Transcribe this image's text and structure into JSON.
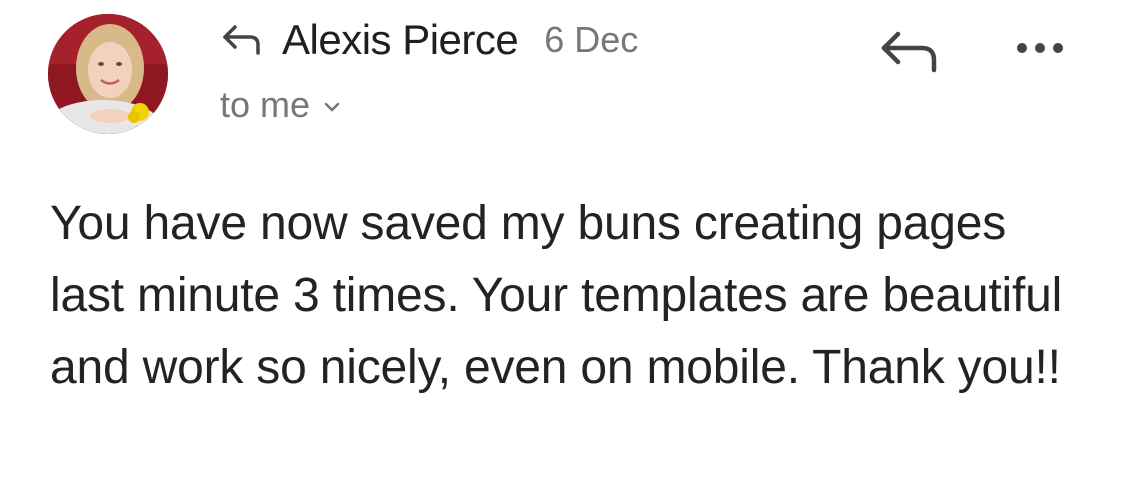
{
  "email": {
    "sender": {
      "name": "Alexis Pierce",
      "avatar_icon": "profile-photo"
    },
    "date": "6 Dec",
    "recipient": "to me",
    "icons": {
      "replied_indicator": "reply-arrow-icon",
      "reply": "reply-icon",
      "more": "more-dots-icon",
      "expand": "chevron-down-icon"
    },
    "body": "You have now saved my buns creating pages last minute 3 times. Your templates are beautiful and work so nicely, even on mobile. Thank you!!"
  },
  "colors": {
    "text_primary": "#1f1f1f",
    "text_secondary": "#777777",
    "icon": "#444444",
    "background": "#ffffff"
  }
}
